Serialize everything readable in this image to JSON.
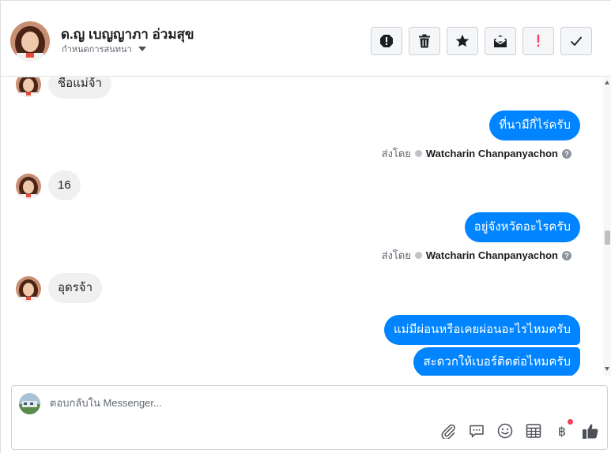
{
  "header": {
    "contact_name": "ด.ญ เบญญาภา อ่วมสุข",
    "label_dropdown": "กำหนดการสนทนา",
    "toolbar_icons": [
      "alert-icon",
      "trash-icon",
      "star-icon",
      "mail-icon",
      "exclamation-icon",
      "check-icon"
    ]
  },
  "conversation": {
    "messages": [
      {
        "from": "customer",
        "text": "ชื่อแม่จ้า"
      },
      {
        "from": "page",
        "text": "ที่นามีกี่ไร่ครับ"
      },
      {
        "from": "customer",
        "text": "16"
      },
      {
        "from": "page",
        "text": "อยู่จังหวัดอะไรครับ"
      },
      {
        "from": "customer",
        "text": "อุดรจ้า"
      },
      {
        "from": "page",
        "text": "แม่มีผ่อนหรือเคยผ่อนอะไรไหมครับ"
      },
      {
        "from": "page",
        "text": "สะดวกให้เบอร์ติดต่อไหมครับ"
      }
    ],
    "sent_by_label": "ส่งโดย",
    "agent_name": "Watcharin Chanpanyachon"
  },
  "composer": {
    "placeholder": "ตอบกลับใน Messenger...",
    "value": "",
    "tools": [
      "attachment-icon",
      "saved-reply-icon",
      "emoji-icon",
      "appointment-icon",
      "baht-payment-icon",
      "thumbs-up-icon"
    ],
    "baht_glyph": "฿"
  },
  "colors": {
    "outgoing_bubble": "#0084ff",
    "incoming_bubble": "#f1f0f0",
    "notification_dot": "#fa3e5d",
    "alert_red": "#fa3e5d"
  }
}
